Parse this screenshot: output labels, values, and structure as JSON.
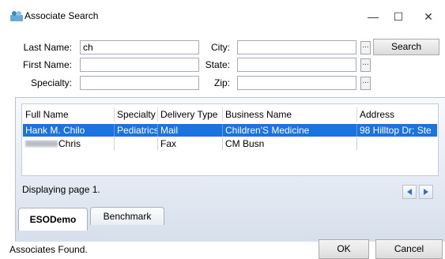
{
  "window": {
    "title": "Associate Search",
    "minimize_glyph": "—",
    "maximize_glyph": "☐",
    "close_glyph": "✕",
    "icon": "people-icon"
  },
  "form": {
    "last_name_label": "Last Name:",
    "last_name_value": "ch",
    "first_name_label": "First Name:",
    "first_name_value": "",
    "specialty_label": "Specialty:",
    "specialty_value": "",
    "city_label": "City:",
    "city_value": "",
    "state_label": "State:",
    "state_value": "",
    "zip_label": "Zip:",
    "zip_value": "",
    "lookup_button_label": "...",
    "search_button_label": "Search"
  },
  "grid": {
    "columns": [
      "Full Name",
      "Specialty",
      "Delivery Type",
      "Business Name",
      "Address"
    ],
    "rows": [
      {
        "full_name": "Hank M. Chilo",
        "specialty": "Pediatrics",
        "delivery_type": "Mail",
        "business_name": "Children'S Medicine",
        "address": "98 Hilltop Dr;  Ste"
      },
      {
        "full_name": "Chris",
        "specialty": "",
        "delivery_type": "Fax",
        "business_name": "CM Busn",
        "address": ""
      }
    ],
    "selected_row": 0
  },
  "paging": {
    "text": "Displaying page 1."
  },
  "tabs": [
    {
      "label": "ESODemo",
      "active": true
    },
    {
      "label": "Benchmark",
      "active": false
    }
  ],
  "footer": {
    "status": "Associates Found.",
    "ok_label": "OK",
    "cancel_label": "Cancel"
  },
  "colors": {
    "selection": "#1b73e0",
    "nav_arrow": "#2a6fd6"
  }
}
